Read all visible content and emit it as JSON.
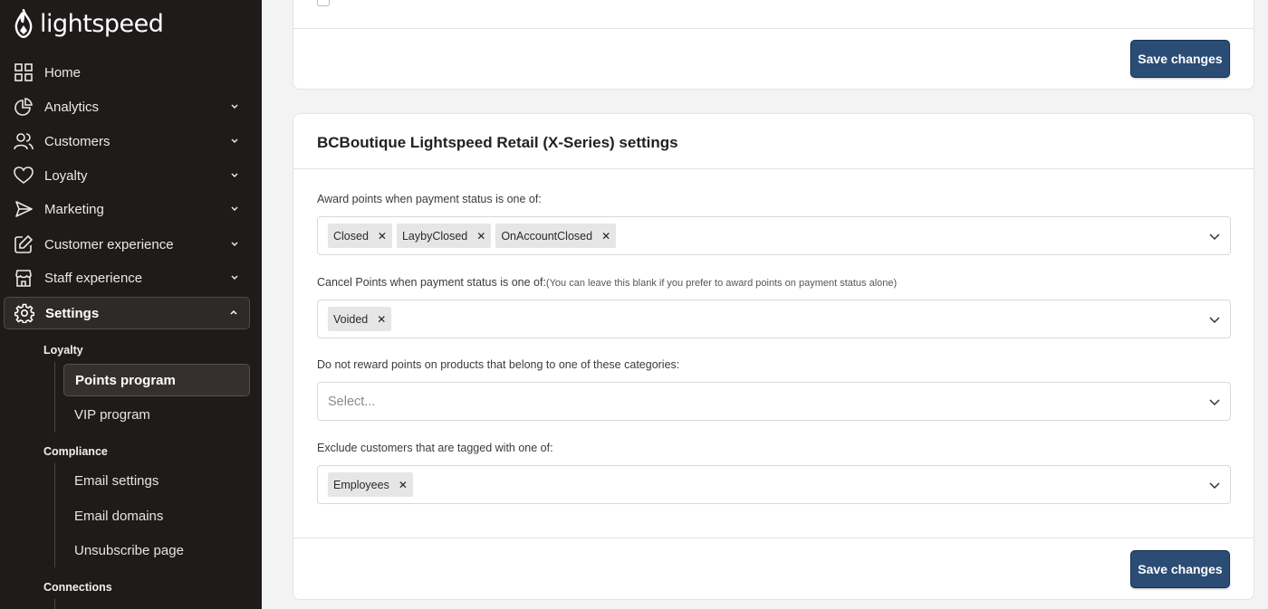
{
  "brand": {
    "name": "lightspeed"
  },
  "sidebar": {
    "items": [
      {
        "label": "Home",
        "icon": "grid-icon"
      },
      {
        "label": "Analytics",
        "icon": "pie-chart-icon"
      },
      {
        "label": "Customers",
        "icon": "users-icon"
      },
      {
        "label": "Loyalty",
        "icon": "heart-icon"
      },
      {
        "label": "Marketing",
        "icon": "send-icon"
      },
      {
        "label": "Customer experience",
        "icon": "edit-icon"
      },
      {
        "label": "Staff experience",
        "icon": "store-icon"
      },
      {
        "label": "Settings",
        "icon": "gear-icon"
      }
    ],
    "settings_sections": [
      {
        "heading": "Loyalty",
        "items": [
          {
            "label": "Points program"
          },
          {
            "label": "VIP program"
          }
        ]
      },
      {
        "heading": "Compliance",
        "items": [
          {
            "label": "Email settings"
          },
          {
            "label": "Email domains"
          },
          {
            "label": "Unsubscribe page"
          }
        ]
      },
      {
        "heading": "Connections",
        "items": []
      }
    ]
  },
  "top_card": {
    "save_label": "Save changes"
  },
  "settings_card": {
    "title": "BCBoutique Lightspeed Retail (X-Series) settings",
    "fields": [
      {
        "label": "Award points when payment status is one of:",
        "hint": "",
        "chips": [
          "Closed",
          "LaybyClosed",
          "OnAccountClosed"
        ],
        "placeholder": ""
      },
      {
        "label": "Cancel Points when payment status is one of:",
        "hint": "(You can leave this blank if you prefer to award points on payment status alone)",
        "chips": [
          "Voided"
        ],
        "placeholder": ""
      },
      {
        "label": "Do not reward points on products that belong to one of these categories:",
        "hint": "",
        "chips": [],
        "placeholder": "Select..."
      },
      {
        "label": "Exclude customers that are tagged with one of:",
        "hint": "",
        "chips": [
          "Employees"
        ],
        "placeholder": ""
      }
    ],
    "save_label": "Save changes"
  },
  "colors": {
    "sidebar_bg": "#1e1b1a",
    "button_bg": "#2b4c74",
    "page_bg": "#f3f3f4"
  }
}
